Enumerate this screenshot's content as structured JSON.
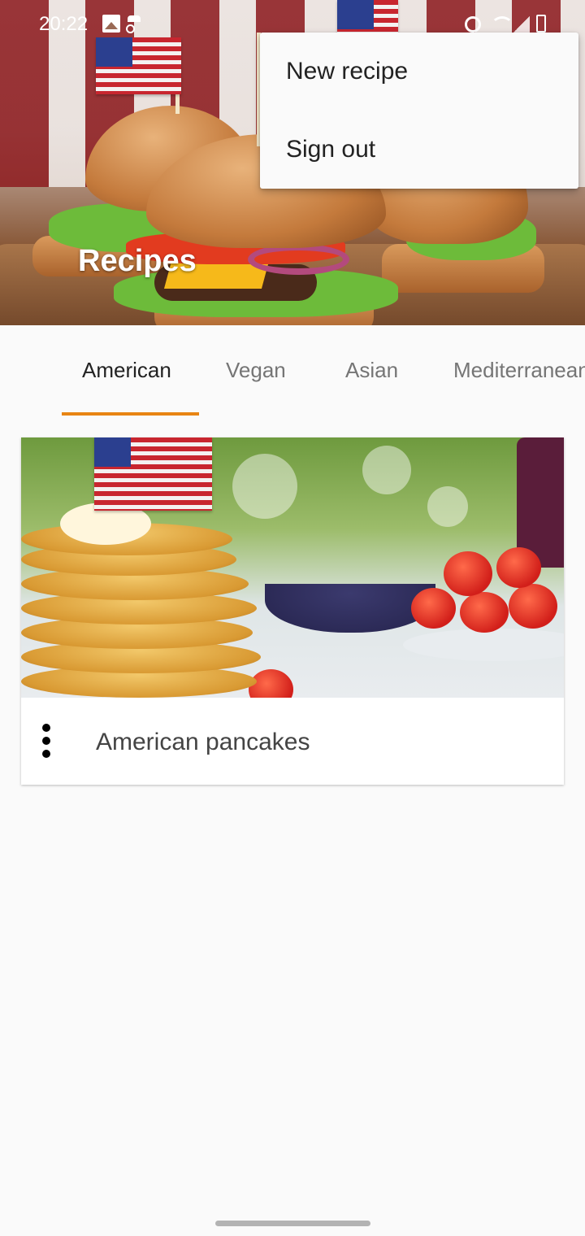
{
  "status_bar": {
    "time": "20:22",
    "left_icons": [
      "gallery-icon",
      "incognito-icon"
    ],
    "right_icons": [
      "alarm-icon",
      "wifi-icon",
      "signal-icon",
      "battery-icon"
    ]
  },
  "header": {
    "title": "Recipes"
  },
  "overflow_menu": {
    "items": [
      {
        "label": "New recipe"
      },
      {
        "label": "Sign out"
      }
    ]
  },
  "tabs": {
    "items": [
      {
        "label": "American",
        "active": true
      },
      {
        "label": "Vegan",
        "active": false
      },
      {
        "label": "Asian",
        "active": false
      },
      {
        "label": "Mediterranean",
        "active": false
      }
    ],
    "indicator_color": "#e88513"
  },
  "recipes": [
    {
      "title": "American pancakes",
      "menu_icon": "more-vert-icon"
    }
  ],
  "colors": {
    "accent": "#e88513",
    "background": "#fafafa"
  }
}
